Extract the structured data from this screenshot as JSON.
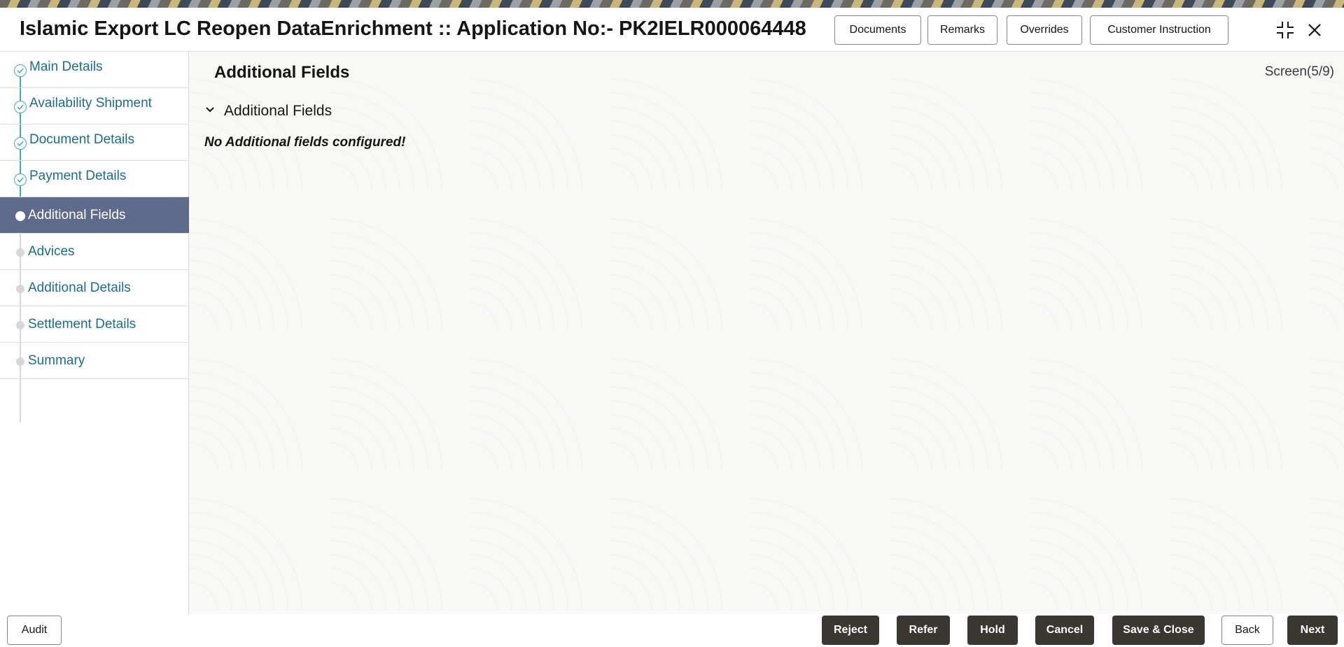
{
  "window": {
    "title": "Islamic Export LC Reopen DataEnrichment :: Application No:- PK2IELR000064448"
  },
  "header": {
    "buttons": [
      {
        "id": "documents",
        "label": "Documents"
      },
      {
        "id": "remarks",
        "label": "Remarks"
      },
      {
        "id": "overrides",
        "label": "Overrides"
      },
      {
        "id": "customer-instruction",
        "label": "Customer Instruction"
      }
    ],
    "icons": [
      "collapse-icon",
      "close-icon"
    ]
  },
  "sidebar": {
    "steps": [
      {
        "label": "Main Details",
        "state": "complete"
      },
      {
        "label": "Availability Shipment",
        "state": "complete"
      },
      {
        "label": "Document Details",
        "state": "complete"
      },
      {
        "label": "Payment Details",
        "state": "complete"
      },
      {
        "label": "Additional Fields",
        "state": "active"
      },
      {
        "label": "Advices",
        "state": "pending"
      },
      {
        "label": "Additional Details",
        "state": "pending"
      },
      {
        "label": "Settlement Details",
        "state": "pending"
      },
      {
        "label": "Summary",
        "state": "pending"
      }
    ]
  },
  "main": {
    "page_title": "Additional Fields",
    "screen_indicator": "Screen(5/9)",
    "section": {
      "label": "Additional Fields",
      "expanded": true,
      "empty_message": "No Additional fields configured!"
    }
  },
  "footer": {
    "left_buttons": [
      {
        "id": "audit",
        "label": "Audit"
      }
    ],
    "right_buttons": [
      {
        "id": "reject",
        "label": "Reject",
        "style": "dark"
      },
      {
        "id": "refer",
        "label": "Refer",
        "style": "dark"
      },
      {
        "id": "hold",
        "label": "Hold",
        "style": "dark"
      },
      {
        "id": "cancel",
        "label": "Cancel",
        "style": "dark"
      },
      {
        "id": "save-close",
        "label": "Save & Close",
        "style": "dark"
      },
      {
        "id": "back",
        "label": "Back",
        "style": "light"
      },
      {
        "id": "next",
        "label": "Next",
        "style": "dark"
      }
    ]
  },
  "colors": {
    "active_step_bg": "#5f6b8a",
    "link_text": "#1a6e8a",
    "check_ring": "#3fa9c9",
    "dark_button": "#3a3631"
  }
}
